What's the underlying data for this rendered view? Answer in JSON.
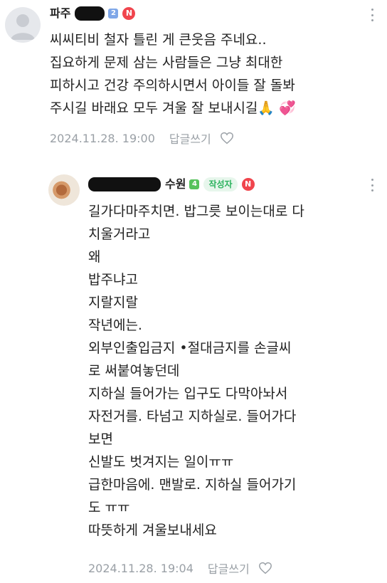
{
  "comments": [
    {
      "nickname": "파주",
      "level": "2",
      "n_badge": "N",
      "lines": [
        "씨씨티비 철자 틀린 게 큰웃음 주네요..",
        "집요하게 문제 삼는 사람들은 그냥 최대한",
        "피하시고 건강 주의하시면서 아이들 잘 돌봐",
        "주시길 바래요 모두 겨울 잘 보내시길🙏 💞"
      ],
      "timestamp": "2024.11.28. 19:00",
      "reply_label": "답글쓰기"
    },
    {
      "nickname": "수원",
      "level": "4",
      "author_label": "작성자",
      "n_badge": "N",
      "lines": [
        "길가다마주치면. 밥그릇 보이는대로 다",
        "치울거라고",
        "왜",
        "밥주냐고",
        "지랄지랄",
        "작년에는.",
        "외부인출입금지  •절대금지를 손글씨",
        "로 써붙여놓던데",
        "지하실 들어가는 입구도 다막아놔서",
        "자전거를. 타넘고 지하실로. 들어가다",
        "보면",
        "신발도 벗겨지는 일이ㅠㅠ",
        "급한마음에. 맨발로. 지하실 들어가기",
        "도 ㅠㅠ",
        "따뜻하게 겨울보내세요"
      ],
      "timestamp": "2024.11.28. 19:04",
      "reply_label": "답글쓰기"
    }
  ]
}
